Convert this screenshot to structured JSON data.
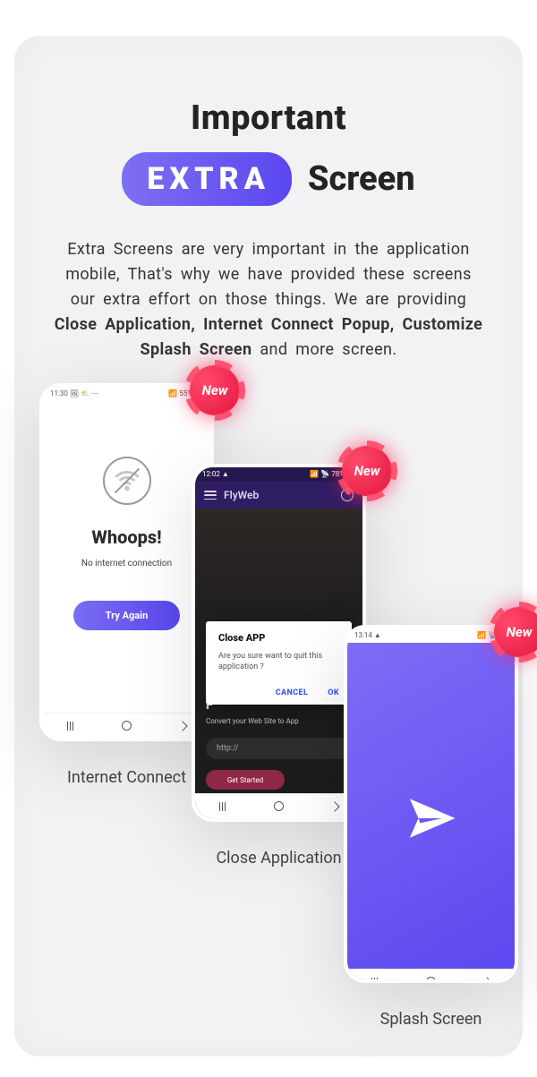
{
  "heading": "Important",
  "pill": "EXTRA",
  "screen_word": "Screen",
  "paragraph": {
    "pre": "Extra Screens are very important in the application mobile, That's why we have provided these screens our extra effort on those things. We are providing ",
    "bold": "Close Application, Internet Connect Popup, Customize Splash Screen",
    "post": " and more screen."
  },
  "badge": "New",
  "captions": {
    "c1": "Internet Connect",
    "c2": "Close Application",
    "c3": "Splash Screen"
  },
  "phone1": {
    "status_left": "11:30 🖼 ⛅ ⋯",
    "status_right": "📶 55% 🔋",
    "whoops": "Whoops!",
    "msg": "No internet connection",
    "btn": "Try Again"
  },
  "phone2": {
    "status_left": "12:02 ▲",
    "status_right": "📶 📡 78% 🔋",
    "app_title": "FlyWeb",
    "hero_title": "F",
    "hero_sub": "Convert your Web Site to App",
    "url_placeholder": "http://",
    "get_started": "Get Started",
    "dialog_title": "Close APP",
    "dialog_text": "Are you sure want to quit this application ?",
    "cancel": "CANCEL",
    "ok": "OK"
  },
  "phone3": {
    "status_left": "13:14 ▲",
    "status_right": "📶 📡 🔋"
  }
}
